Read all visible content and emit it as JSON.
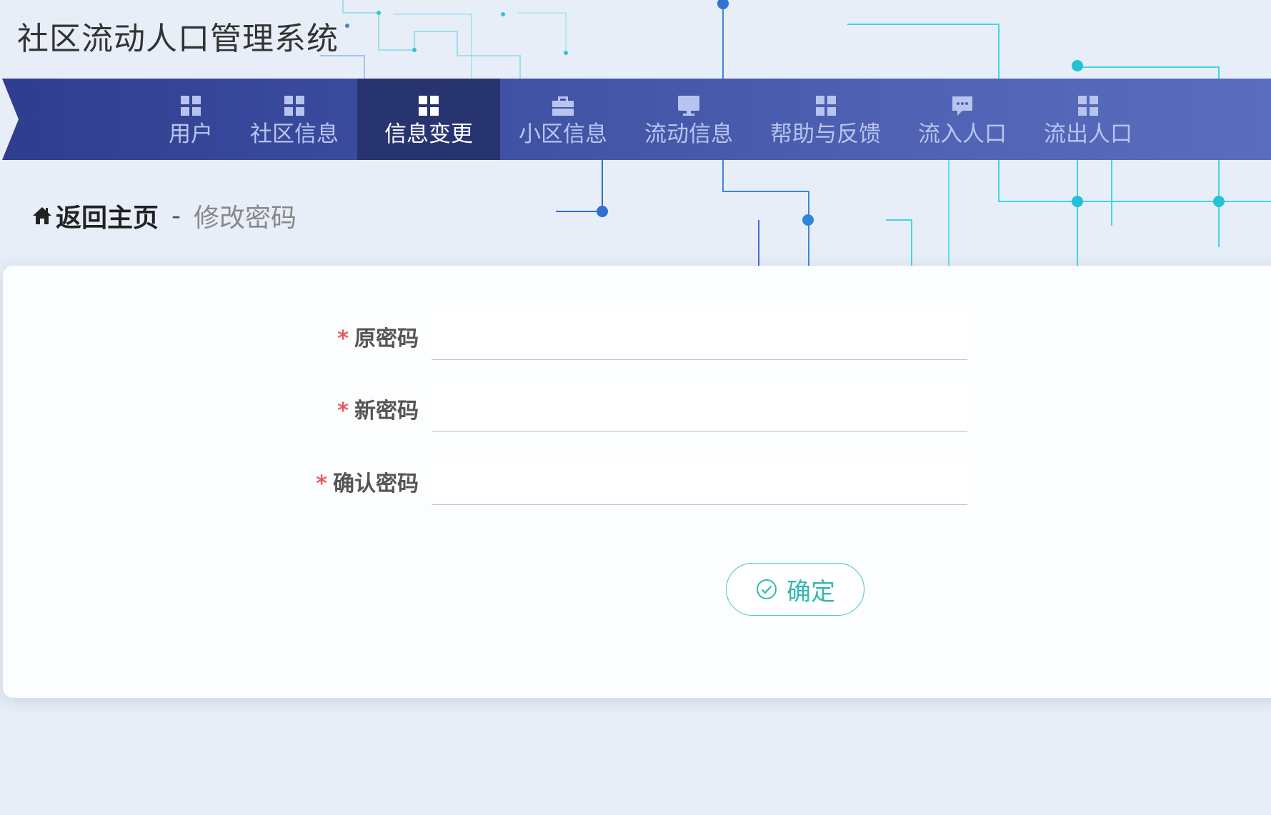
{
  "app": {
    "title": "社区流动人口管理系统"
  },
  "nav": {
    "items": [
      {
        "label": "用户",
        "icon": "grid-icon",
        "active": false
      },
      {
        "label": "社区信息",
        "icon": "grid-icon",
        "active": false
      },
      {
        "label": "信息变更",
        "icon": "grid-icon",
        "active": true
      },
      {
        "label": "小区信息",
        "icon": "briefcase-icon",
        "active": false
      },
      {
        "label": "流动信息",
        "icon": "monitor-icon",
        "active": false
      },
      {
        "label": "帮助与反馈",
        "icon": "grid-icon",
        "active": false
      },
      {
        "label": "流入人口",
        "icon": "chat-icon",
        "active": false
      },
      {
        "label": "流出人口",
        "icon": "grid-icon",
        "active": false
      }
    ]
  },
  "breadcrumb": {
    "home": "返回主页",
    "separator": "-",
    "current": "修改密码"
  },
  "form": {
    "required_mark": "*",
    "old_password_label": "原密码",
    "new_password_label": "新密码",
    "confirm_password_label": "确认密码",
    "old_password_value": "",
    "new_password_value": "",
    "confirm_password_value": "",
    "submit_label": "确定"
  },
  "colors": {
    "nav_start": "#2f3d8e",
    "nav_end": "#5a6dbf",
    "nav_active": "#283470",
    "accent": "#41c5be",
    "required": "#e65a5a"
  }
}
